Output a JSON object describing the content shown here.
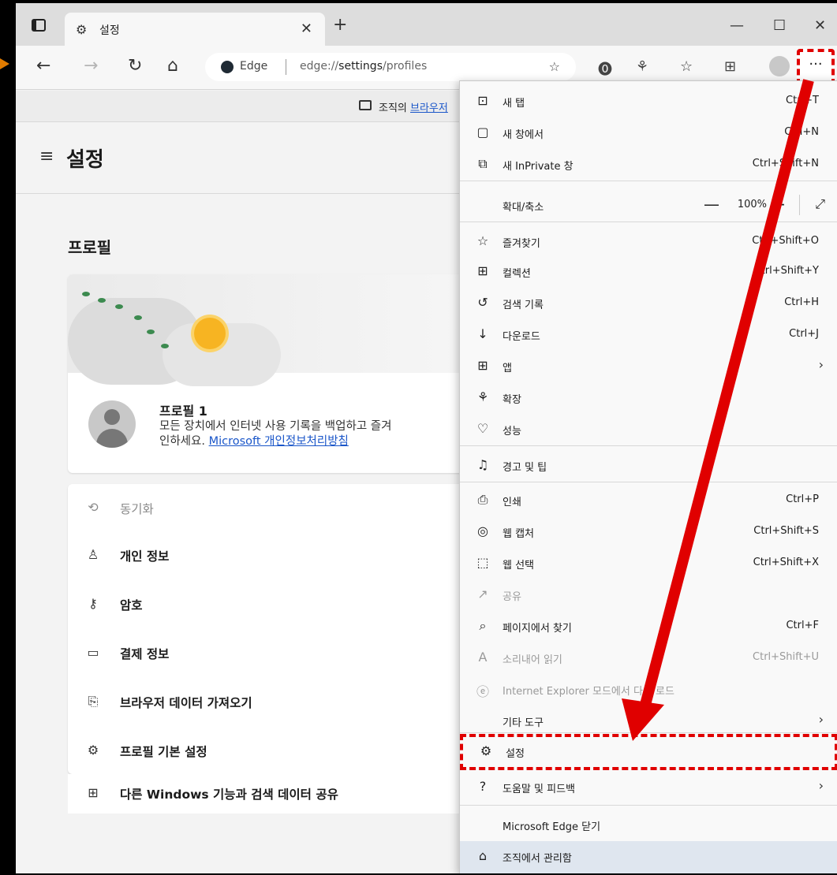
{
  "tab": {
    "title": "설정"
  },
  "address": {
    "browser_label": "Edge",
    "url_prefix": "edge://",
    "url_bold": "settings",
    "url_suffix": "/profiles"
  },
  "infobar": {
    "text_prefix": "조직의 ",
    "link": "브라우저"
  },
  "settings": {
    "page_title": "설정",
    "section_title": "프로필",
    "profile": {
      "name": "프로필 1",
      "desc_line1": "모든 장치에서 인터넷 사용 기록을 백업하고 즐겨",
      "desc_line2_prefix": "인하세요. ",
      "desc_link": "Microsoft 개인정보처리방침"
    },
    "items": [
      {
        "label": "동기화",
        "icon": "sync-icon"
      },
      {
        "label": "개인 정보",
        "icon": "person-icon"
      },
      {
        "label": "암호",
        "icon": "key-icon"
      },
      {
        "label": "결제 정보",
        "icon": "card-icon"
      },
      {
        "label": "브라우저 데이터 가져오기",
        "icon": "import-icon"
      },
      {
        "label": "프로필 기본 설정",
        "icon": "people-settings-icon"
      },
      {
        "label": "다른 Windows 기능과 검색 데이터 공유",
        "icon": "windows-icon"
      }
    ]
  },
  "menu": {
    "new_tab": {
      "label": "새 탭",
      "shortcut": "Ctrl+T"
    },
    "new_window": {
      "label": "새 창에서",
      "shortcut": "Ctrl+N"
    },
    "new_inprivate": {
      "label": "새 InPrivate 창",
      "shortcut": "Ctrl+Shift+N"
    },
    "zoom": {
      "label": "확대/축소",
      "value": "100%"
    },
    "favorites": {
      "label": "즐겨찾기",
      "shortcut": "Ctrl+Shift+O"
    },
    "collections": {
      "label": "컬렉션",
      "shortcut": "Ctrl+Shift+Y"
    },
    "history": {
      "label": "검색 기록",
      "shortcut": "Ctrl+H"
    },
    "downloads": {
      "label": "다운로드",
      "shortcut": "Ctrl+J"
    },
    "apps": {
      "label": "앱"
    },
    "extensions": {
      "label": "확장"
    },
    "performance": {
      "label": "성능"
    },
    "alerts": {
      "label": "경고 및 팁"
    },
    "print": {
      "label": "인쇄",
      "shortcut": "Ctrl+P"
    },
    "web_capture": {
      "label": "웹 캡처",
      "shortcut": "Ctrl+Shift+S"
    },
    "web_select": {
      "label": "웹 선택",
      "shortcut": "Ctrl+Shift+X"
    },
    "share": {
      "label": "공유"
    },
    "find": {
      "label": "페이지에서 찾기",
      "shortcut": "Ctrl+F"
    },
    "read_aloud": {
      "label": "소리내어 읽기",
      "shortcut": "Ctrl+Shift+U"
    },
    "ie_mode": {
      "label": "Internet Explorer 모드에서 다시 로드"
    },
    "more_tools": {
      "label": "기타 도구"
    },
    "settings": {
      "label": "설정"
    },
    "help": {
      "label": "도움말 및 피드백"
    },
    "close_edge": {
      "label": "Microsoft Edge 닫기"
    },
    "managed": {
      "label": "조직에서 관리함"
    }
  },
  "colors": {
    "annotation_red": "#e00000",
    "link_blue": "#1a56c9"
  }
}
